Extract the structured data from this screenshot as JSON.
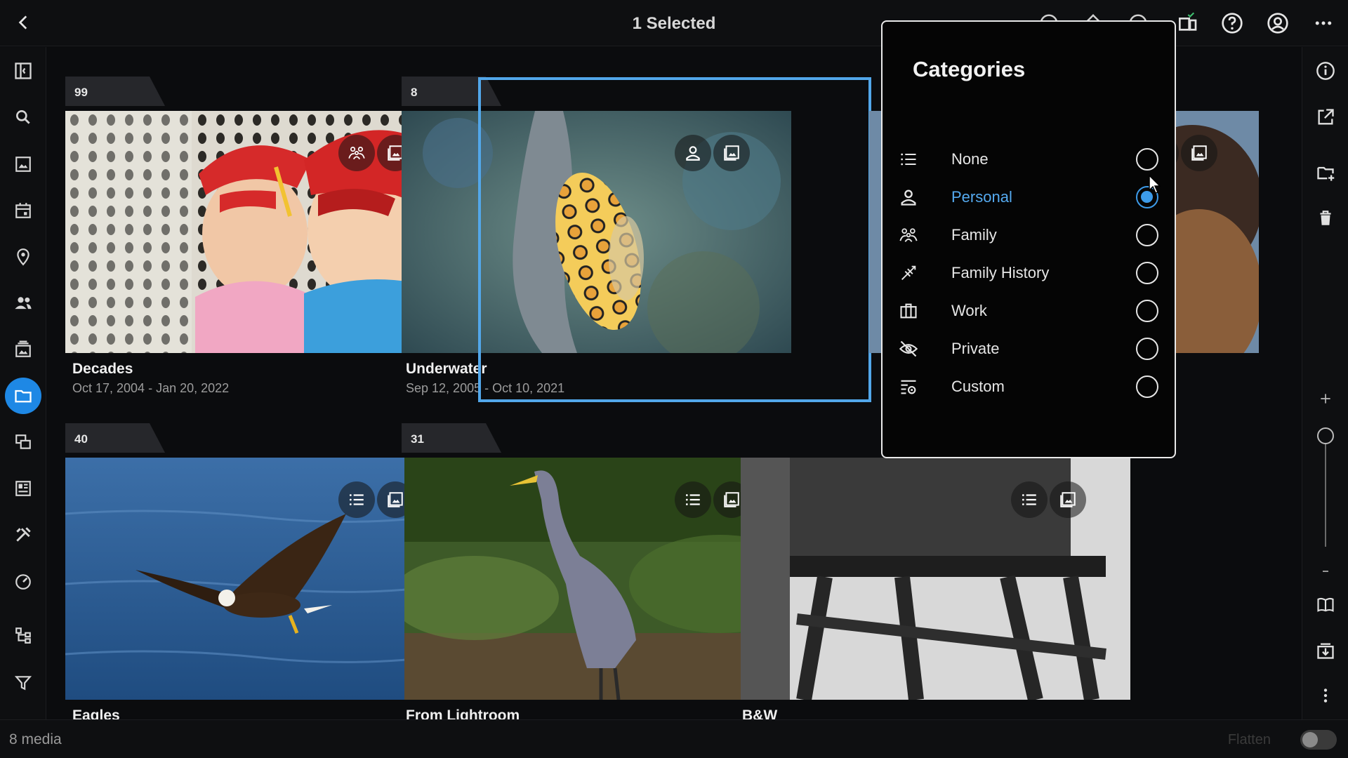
{
  "header": {
    "title": "1 Selected",
    "icons": [
      "back-icon",
      "help-icon",
      "account-icon",
      "more-icon",
      "devices-icon"
    ]
  },
  "left_nav": [
    "sidebar-toggle-icon",
    "search-icon",
    "photos-icon",
    "calendar-icon",
    "map-pin-icon",
    "people-icon",
    "albums-icon",
    "folder-icon",
    "collections-icon",
    "gallery-icon",
    "tools-icon",
    "dashboard-icon",
    "hierarchy-icon",
    "filter-icon"
  ],
  "right_nav": [
    "info-icon",
    "open-external-icon",
    "new-folder-icon",
    "trash-icon",
    "zoom-in-icon",
    "zoom-out-icon",
    "book-icon",
    "import-icon",
    "more-vertical-icon"
  ],
  "albums": [
    {
      "count": "99",
      "name": "Decades",
      "dates": "Oct 17, 2004 - Jan 20, 2022",
      "category_icon": "family-icon",
      "selected": false
    },
    {
      "count": "8",
      "name": "Underwater",
      "dates": "Sep 12, 2005 - Oct 10, 2021",
      "category_icon": "person-icon",
      "selected": true
    },
    {
      "count": "",
      "name": "",
      "dates": "",
      "category_icon": "list-icon",
      "selected": false
    },
    {
      "count": "40",
      "name": "Eagles",
      "dates": "",
      "category_icon": "list-icon",
      "selected": false
    },
    {
      "count": "31",
      "name": "From Lightroom",
      "dates": "",
      "category_icon": "list-icon",
      "selected": false
    },
    {
      "count": "",
      "name": "B&W",
      "dates": "",
      "category_icon": "list-icon",
      "selected": false
    }
  ],
  "categories_popup": {
    "title": "Categories",
    "items": [
      {
        "label": "None",
        "icon": "list-icon",
        "selected": false
      },
      {
        "label": "Personal",
        "icon": "person-icon",
        "selected": true
      },
      {
        "label": "Family",
        "icon": "family-icon",
        "selected": false
      },
      {
        "label": "Family History",
        "icon": "family-tree-icon",
        "selected": false
      },
      {
        "label": "Work",
        "icon": "briefcase-icon",
        "selected": false
      },
      {
        "label": "Private",
        "icon": "eye-off-icon",
        "selected": false
      },
      {
        "label": "Custom",
        "icon": "custom-settings-icon",
        "selected": false
      }
    ]
  },
  "status": {
    "media_count": "8 media",
    "flatten_label": "Flatten",
    "flatten_on": false
  },
  "colors": {
    "accent": "#1e88e5",
    "selection_border": "#52a7ea",
    "background": "#0b0c0e"
  }
}
